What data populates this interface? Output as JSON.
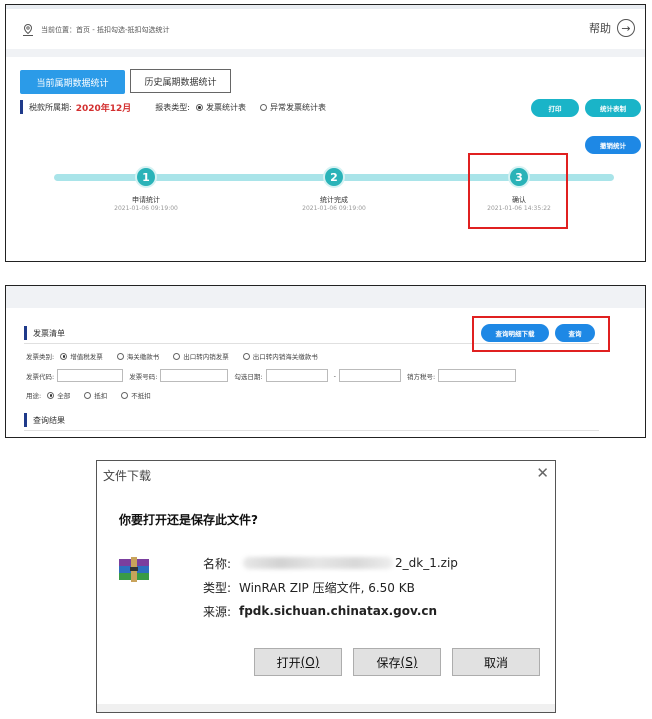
{
  "panel1": {
    "breadcrumb": "当前位置：首页 - 抵扣勾选-抵扣勾选统计",
    "help_label": "帮助",
    "tabs": {
      "current": "当前属期数据统计",
      "history": "历史属期数据统计"
    },
    "period_label": "税款所属期:",
    "period_value": "2020年12月",
    "report_type_label": "报表类型:",
    "report_options": [
      "发票统计表",
      "异常发票统计表"
    ],
    "buttons": {
      "print": "打印",
      "stat_sign": "统计表制",
      "cancel_stat": "撤销统计"
    },
    "steps": [
      {
        "num": "1",
        "label": "申请统计",
        "time": "2021-01-06 09:19:00"
      },
      {
        "num": "2",
        "label": "统计完成",
        "time": "2021-01-06 09:19:00"
      },
      {
        "num": "3",
        "label": "确认",
        "time": "2021-01-06 14:35:22"
      }
    ]
  },
  "panel2": {
    "section_title": "发票清单",
    "btn_download": "查询明细下载",
    "btn_query": "查询",
    "invoice_type_label": "发票类别:",
    "invoice_types": [
      "增值税发票",
      "海关缴款书",
      "出口转内销发票",
      "出口转内销海关缴款书"
    ],
    "code_label": "发票代码:",
    "number_label": "发票号码:",
    "date_label": "勾选日期:",
    "date_sep": "-",
    "seller_tax_label": "销方税号:",
    "usage_label": "用途:",
    "usage_options": [
      "全部",
      "抵扣",
      "不抵扣"
    ],
    "result_title": "查询结果"
  },
  "dialog": {
    "title": "文件下载",
    "close": "✕",
    "question": "你要打开还是保存此文件?",
    "name_label": "名称:",
    "name_suffix": "2_dk_1.zip",
    "type_label": "类型:",
    "type_value": "WinRAR ZIP 压缩文件, 6.50 KB",
    "source_label": "来源:",
    "source_value": "fpdk.sichuan.chinatax.gov.cn",
    "btn_open": "打开",
    "btn_open_key": "(O)",
    "btn_save": "保存",
    "btn_save_key": "(S)",
    "btn_cancel": "取消"
  },
  "colors": {
    "accent": "#2b9be8",
    "step": "#2ab3b8",
    "highlight": "#e02020",
    "period": "#d32f2f"
  },
  "icons": {
    "location": "location-pin-icon",
    "help": "arrow-right-circle-icon",
    "archive": "winrar-archive-icon",
    "close": "close-icon"
  }
}
